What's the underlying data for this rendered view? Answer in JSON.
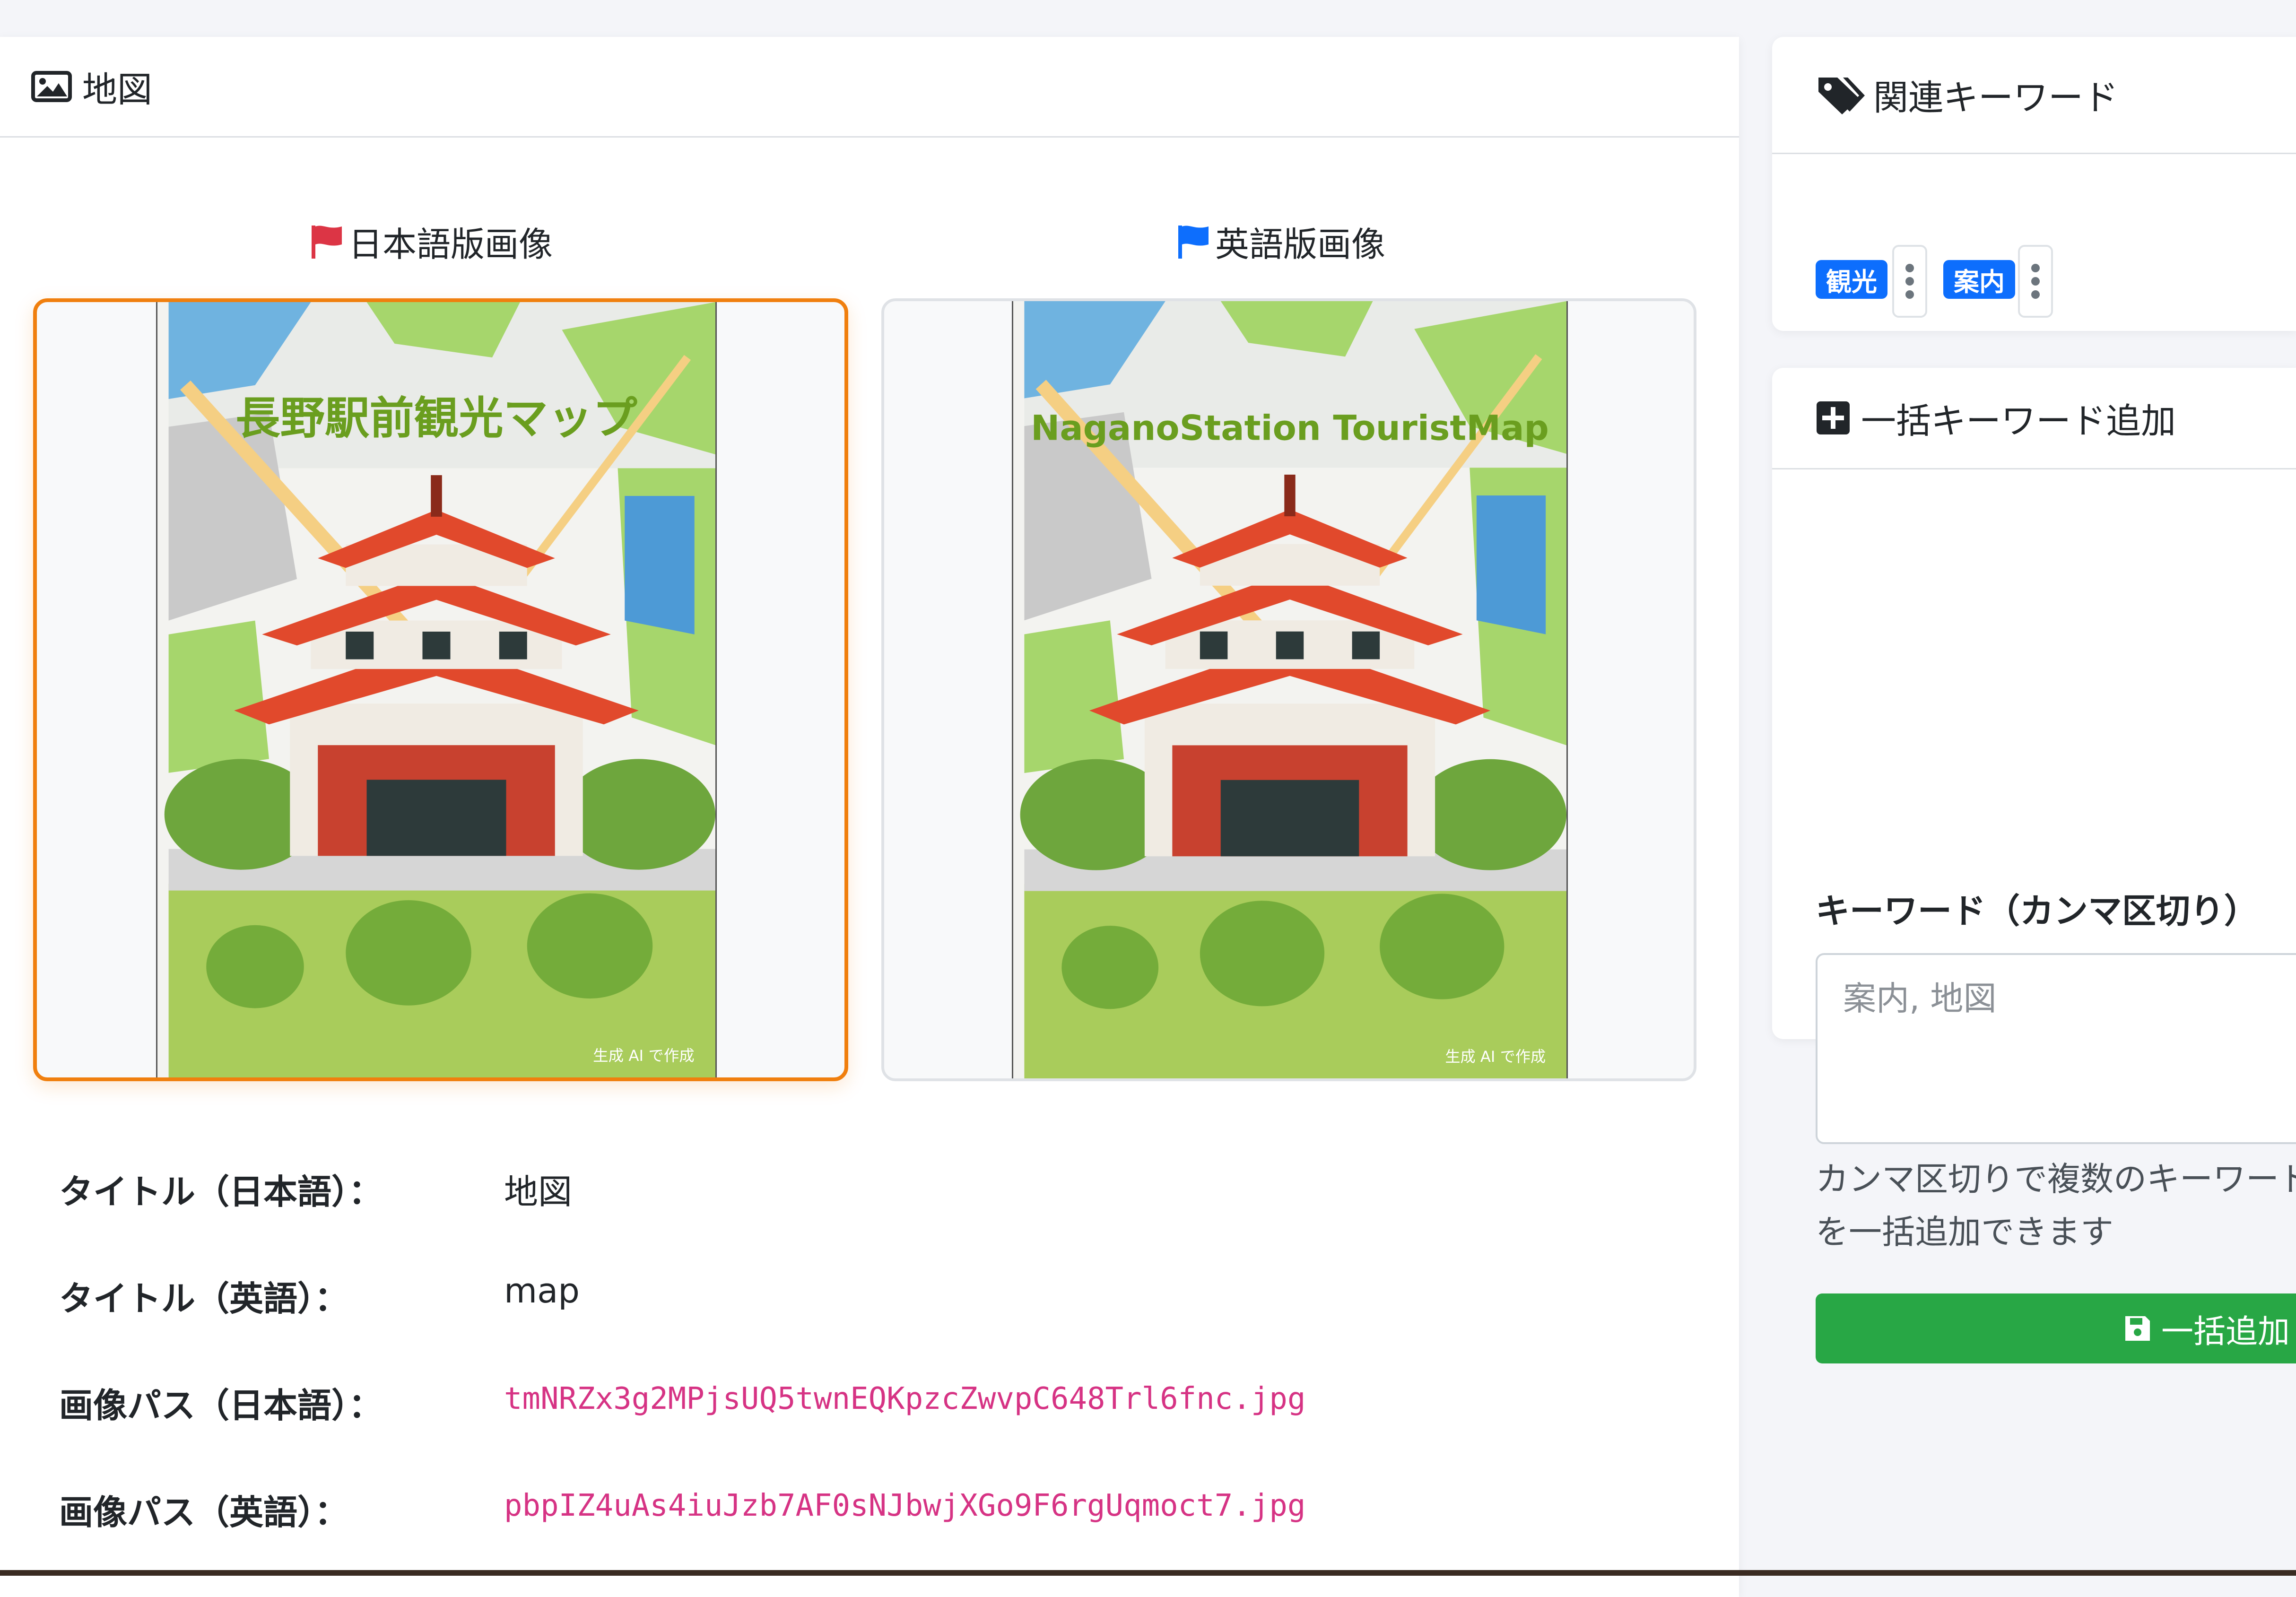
{
  "map_card": {
    "title": "地図",
    "images": {
      "ja_label": "日本語版画像",
      "en_label": "英語版画像",
      "ja_map_title": "長野駅前観光マップ",
      "en_map_title": "NaganoStation  TouristMap",
      "watermark": "生成 AI で作成"
    },
    "info": [
      {
        "label": "タイトル（日本語）：",
        "value": "地図"
      },
      {
        "label": "タイトル（英語）：",
        "value": "map"
      },
      {
        "label": "画像パス（日本語）：",
        "value": "tmNRZx3g2MPjsUQ5twnEQKpzcZwvpC648Trl6fnc.jpg"
      },
      {
        "label": "画像パス（英語）：",
        "value": "pbpIZ4uAs4iuJzb7AF0sNJbwjXGo9F6rgUqmoct7.jpg"
      }
    ]
  },
  "keywords_card": {
    "title": "関連キーワード",
    "badges": [
      {
        "label": "観光"
      },
      {
        "label": "案内"
      }
    ]
  },
  "bulk_card": {
    "title": "一括キーワード追加",
    "label": "キーワード（カンマ区切り）",
    "placeholder": "案内, 地図",
    "help": "カンマ区切りで複数のキーワードを一括追加できます",
    "submit": "一括追加"
  },
  "colors": {
    "selected_border": "#f07f0e",
    "badge": "#0d6efd",
    "submit": "#28a745",
    "code": "#d63384",
    "flag_ja": "#dc3545",
    "flag_en": "#0d6efd"
  }
}
